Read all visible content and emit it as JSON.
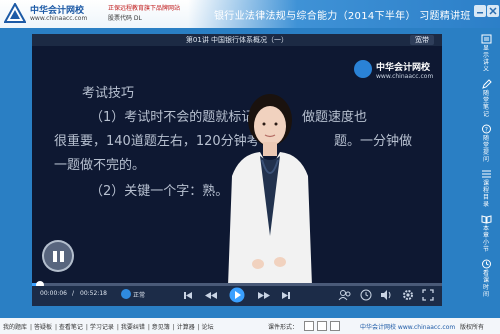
{
  "header": {
    "brand_name": "中华会计网校",
    "brand_url": "www.chinaacc.com",
    "slogan": "正保远程教育旗下品牌网站",
    "stock_code": "股票代码   DL",
    "course_title": "银行业法律法规与综合能力（2014下半年） 习题精讲班"
  },
  "player": {
    "lecture_title": "第01讲   中国银行体系概况（一）",
    "quality_label": "宽带",
    "watermark_name": "中华会计网校",
    "watermark_url": "www.chinaacc.com",
    "current_time": "00:00:06",
    "total_time": "00:52:18",
    "speed_label": "正常",
    "progress_fraction": 0.02
  },
  "slide": {
    "heading": "考试技巧",
    "line1": "（1）考试时不会的题就标记",
    "line1_tail": "做题速度也",
    "line2": "很重要，140道题左右，120分钟考",
    "line2_tail": "题。一分钟做",
    "line3": "一题做不完的。",
    "line4": "（2）关键一个字：熟。"
  },
  "sidebar": {
    "items": [
      {
        "label": "显示讲义",
        "icon": "handout-icon"
      },
      {
        "label": "随堂笔记",
        "icon": "pencil-icon"
      },
      {
        "label": "随堂提问",
        "icon": "question-icon"
      },
      {
        "label": "课程目录",
        "icon": "list-icon"
      },
      {
        "label": "本章小节",
        "icon": "book-icon"
      },
      {
        "label": "看课时间",
        "icon": "clock-icon"
      }
    ]
  },
  "footer": {
    "nav": [
      "我的题库",
      "答疑板",
      "查看笔记",
      "学习记录",
      "我要纠错",
      "意见簿",
      "计算器",
      "论坛"
    ],
    "course_form_label": "课件形式：",
    "logo_text": "中华会计网校  www.chinaacc.com",
    "copyright": "版权所有"
  },
  "colors": {
    "accent": "#2a7fc4",
    "brand_blue": "#1d5aa6",
    "video_bg": "#0e1832",
    "progress": "#3da2ff"
  }
}
